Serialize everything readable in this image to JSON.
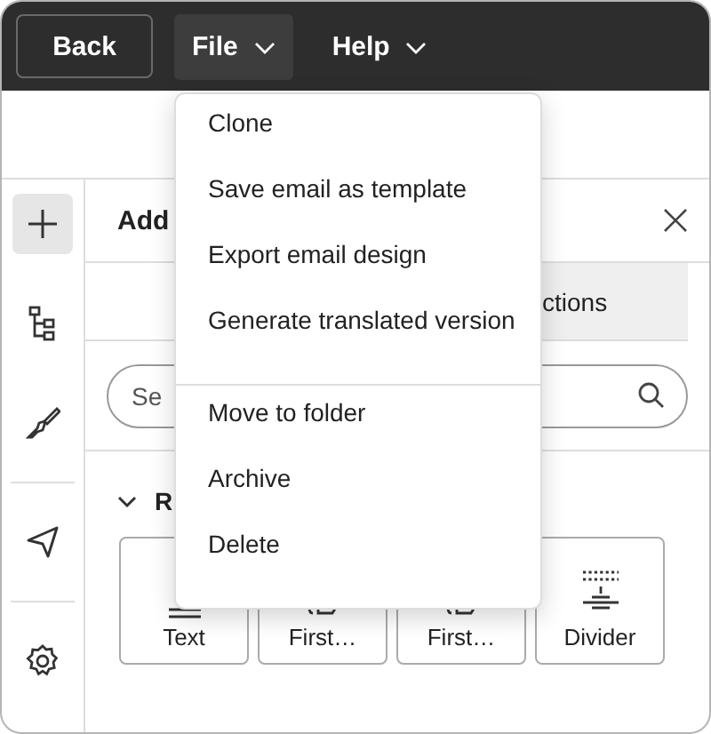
{
  "header": {
    "back": "Back",
    "menus": [
      {
        "label": "File",
        "open": true
      },
      {
        "label": "Help",
        "open": false
      }
    ]
  },
  "rail": {
    "groups": [
      {
        "items": [
          {
            "kind": "add",
            "selected": true
          },
          {
            "kind": "tree",
            "selected": false
          },
          {
            "kind": "brush",
            "selected": false
          }
        ]
      },
      {
        "items": [
          {
            "kind": "send",
            "selected": false
          }
        ]
      },
      {
        "items": [
          {
            "kind": "settings",
            "selected": false
          }
        ]
      }
    ]
  },
  "panel": {
    "title": "Add",
    "tabs": [
      {
        "label": "ctions",
        "selected": false
      }
    ],
    "search": {
      "placeholder": "Se"
    },
    "section": {
      "title": "R",
      "expanded": true
    },
    "tiles": [
      {
        "kind": "text",
        "label": "Text"
      },
      {
        "kind": "image",
        "label": "First…"
      },
      {
        "kind": "image",
        "label": "First…"
      },
      {
        "kind": "divider",
        "label": "Divider"
      }
    ]
  },
  "menu": {
    "groups": [
      {
        "items": [
          "Clone",
          "Save email as template",
          "Export email design",
          "Generate translated version"
        ]
      },
      {
        "items": [
          "Move to folder",
          "Archive",
          "Delete"
        ]
      }
    ]
  }
}
